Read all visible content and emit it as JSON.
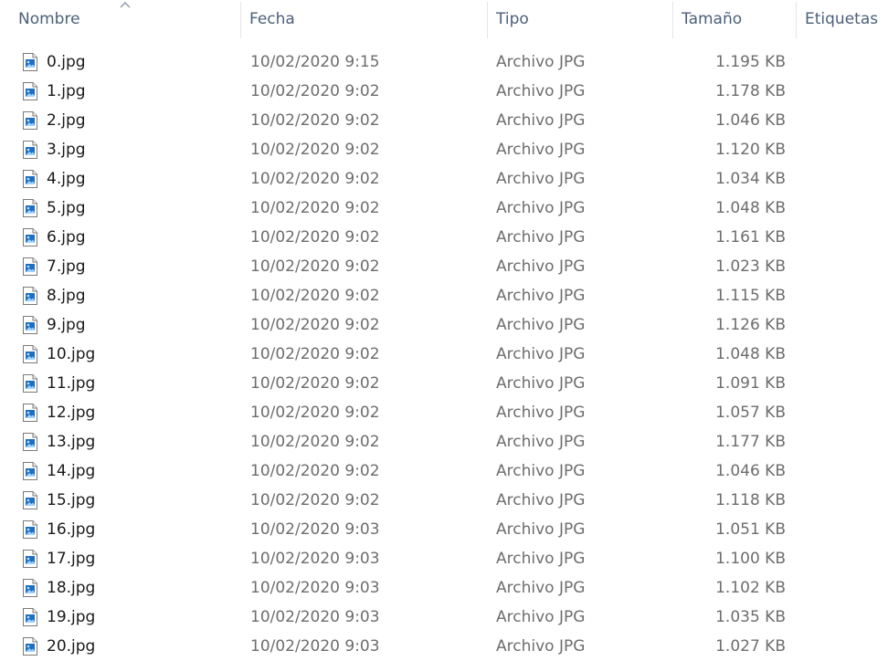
{
  "columns": {
    "name": "Nombre",
    "date": "Fecha",
    "type": "Tipo",
    "size": "Tamaño",
    "tags": "Etiquetas"
  },
  "sort": {
    "column": "name",
    "direction": "ascending",
    "icon": "sort-up-chevron-icon"
  },
  "file_icon": "image-file-icon",
  "files": [
    {
      "name": "0.jpg",
      "date": "10/02/2020 9:15",
      "type": "Archivo JPG",
      "size": "1.195 KB"
    },
    {
      "name": "1.jpg",
      "date": "10/02/2020 9:02",
      "type": "Archivo JPG",
      "size": "1.178 KB"
    },
    {
      "name": "2.jpg",
      "date": "10/02/2020 9:02",
      "type": "Archivo JPG",
      "size": "1.046 KB"
    },
    {
      "name": "3.jpg",
      "date": "10/02/2020 9:02",
      "type": "Archivo JPG",
      "size": "1.120 KB"
    },
    {
      "name": "4.jpg",
      "date": "10/02/2020 9:02",
      "type": "Archivo JPG",
      "size": "1.034 KB"
    },
    {
      "name": "5.jpg",
      "date": "10/02/2020 9:02",
      "type": "Archivo JPG",
      "size": "1.048 KB"
    },
    {
      "name": "6.jpg",
      "date": "10/02/2020 9:02",
      "type": "Archivo JPG",
      "size": "1.161 KB"
    },
    {
      "name": "7.jpg",
      "date": "10/02/2020 9:02",
      "type": "Archivo JPG",
      "size": "1.023 KB"
    },
    {
      "name": "8.jpg",
      "date": "10/02/2020 9:02",
      "type": "Archivo JPG",
      "size": "1.115 KB"
    },
    {
      "name": "9.jpg",
      "date": "10/02/2020 9:02",
      "type": "Archivo JPG",
      "size": "1.126 KB"
    },
    {
      "name": "10.jpg",
      "date": "10/02/2020 9:02",
      "type": "Archivo JPG",
      "size": "1.048 KB"
    },
    {
      "name": "11.jpg",
      "date": "10/02/2020 9:02",
      "type": "Archivo JPG",
      "size": "1.091 KB"
    },
    {
      "name": "12.jpg",
      "date": "10/02/2020 9:02",
      "type": "Archivo JPG",
      "size": "1.057 KB"
    },
    {
      "name": "13.jpg",
      "date": "10/02/2020 9:02",
      "type": "Archivo JPG",
      "size": "1.177 KB"
    },
    {
      "name": "14.jpg",
      "date": "10/02/2020 9:02",
      "type": "Archivo JPG",
      "size": "1.046 KB"
    },
    {
      "name": "15.jpg",
      "date": "10/02/2020 9:02",
      "type": "Archivo JPG",
      "size": "1.118 KB"
    },
    {
      "name": "16.jpg",
      "date": "10/02/2020 9:03",
      "type": "Archivo JPG",
      "size": "1.051 KB"
    },
    {
      "name": "17.jpg",
      "date": "10/02/2020 9:03",
      "type": "Archivo JPG",
      "size": "1.100 KB"
    },
    {
      "name": "18.jpg",
      "date": "10/02/2020 9:03",
      "type": "Archivo JPG",
      "size": "1.102 KB"
    },
    {
      "name": "19.jpg",
      "date": "10/02/2020 9:03",
      "type": "Archivo JPG",
      "size": "1.035 KB"
    },
    {
      "name": "20.jpg",
      "date": "10/02/2020 9:03",
      "type": "Archivo JPG",
      "size": "1.027 KB"
    }
  ],
  "colors": {
    "header_text": "#4c607a",
    "name_text": "#1a1a1a",
    "detail_text": "#6d6d6d",
    "icon_accent": "#1e6fc1"
  }
}
